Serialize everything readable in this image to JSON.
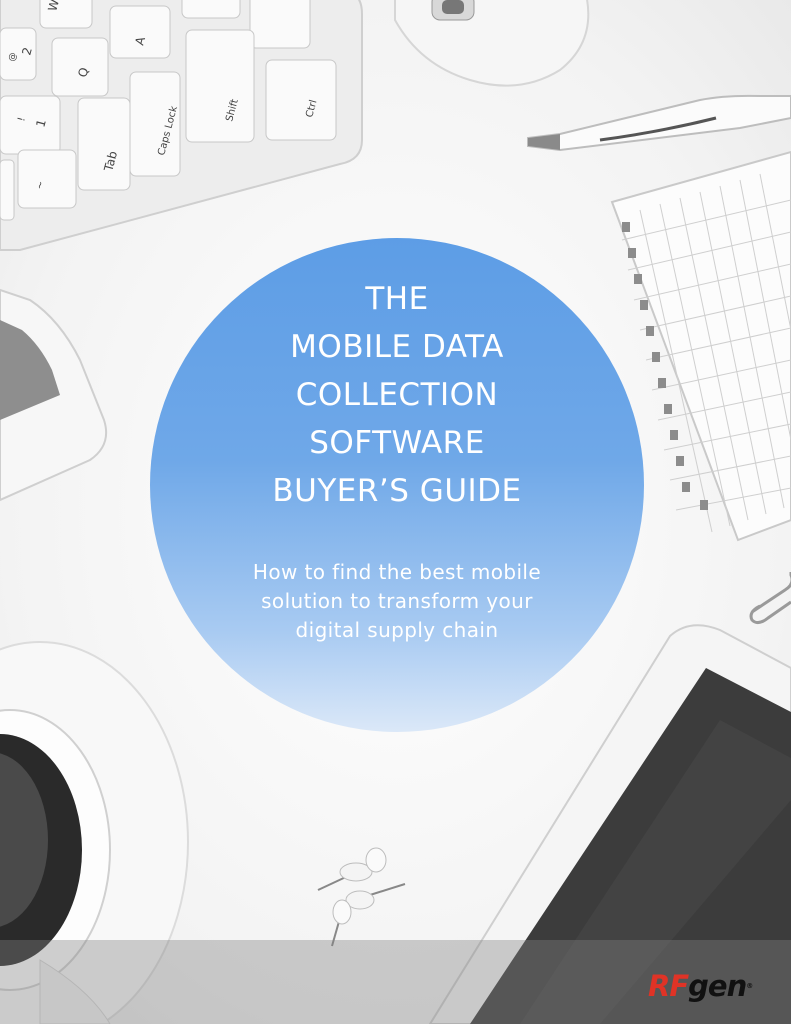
{
  "cover": {
    "title_lines": [
      "THE",
      "MOBILE DATA",
      "COLLECTION",
      "SOFTWARE",
      "BUYER’S GUIDE"
    ],
    "subtitle_lines": [
      "How to find the best mobile",
      "solution to transform your",
      "digital supply chain"
    ]
  },
  "logo": {
    "part1": "RF",
    "part2": "gen",
    "trademark": "®"
  },
  "keyboard": {
    "keys": [
      "W",
      "A",
      "Q",
      "2",
      "1",
      "Tab",
      "Caps Lock",
      "Shift",
      "Ctrl",
      "@",
      "!",
      "~"
    ]
  },
  "colors": {
    "circle_top": "#5d9de6",
    "circle_bottom": "#dbe8f8",
    "logo_red": "#e03326",
    "text": "#ffffff"
  }
}
